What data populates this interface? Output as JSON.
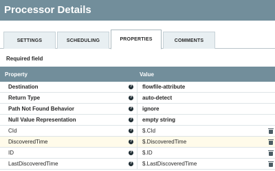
{
  "header": {
    "title": "Processor Details"
  },
  "tabs": [
    {
      "label": "SETTINGS",
      "active": false
    },
    {
      "label": "SCHEDULING",
      "active": false
    },
    {
      "label": "PROPERTIES",
      "active": true
    },
    {
      "label": "COMMENTS",
      "active": false
    }
  ],
  "required_label": "Required field",
  "table": {
    "columns": {
      "property": "Property",
      "value": "Value"
    },
    "rows": [
      {
        "property": "Destination",
        "value": "flowfile-attribute",
        "required": true
      },
      {
        "property": "Return Type",
        "value": "auto-detect",
        "required": true
      },
      {
        "property": "Path Not Found Behavior",
        "value": "ignore",
        "required": true
      },
      {
        "property": "Null Value Representation",
        "value": "empty string",
        "required": true
      },
      {
        "property": "CId",
        "value": "$.CId",
        "required": false
      },
      {
        "property": "DiscoveredTime",
        "value": "$.DiscoveredTime",
        "required": false,
        "highlighted": true
      },
      {
        "property": "ID",
        "value": "$.ID",
        "required": false
      },
      {
        "property": "LastDiscoveredTime",
        "value": "$.LastDiscoveredTime",
        "required": false
      }
    ]
  },
  "colors": {
    "header_bg": "#728e9b",
    "tab_bg": "#e8eff2",
    "row_highlight": "#fffbea"
  },
  "icons": {
    "help": "question-circle-icon",
    "delete": "trash-icon"
  }
}
